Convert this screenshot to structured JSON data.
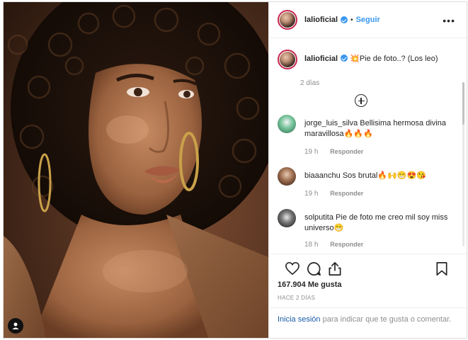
{
  "header": {
    "username": "lalioficial",
    "separator": "•",
    "follow_label": "Seguir",
    "more_label": "•••"
  },
  "caption": {
    "username": "lalioficial",
    "emoji": "💥",
    "text": "Pie de foto..? (Los leo)",
    "time": "2 días"
  },
  "comments": [
    {
      "username": "jorge_luis_silva",
      "text": "Bellisima hermosa divina maravillosa🔥🔥🔥",
      "time": "19 h",
      "reply_label": "Responder"
    },
    {
      "username": "biaaanchu",
      "text": "Sos brutal🔥🙌😁😍😘",
      "time": "19 h",
      "reply_label": "Responder"
    },
    {
      "username": "solputita",
      "text": "Pie de foto me creo mil soy miss universo😁",
      "time": "18 h",
      "reply_label": "Responder"
    }
  ],
  "footer": {
    "likes": "167.904 Me gusta",
    "date": "HACE 2 DÍAS",
    "login_link": "Inicia sesión",
    "login_text": " para indicar que te gusta o comentar."
  },
  "icons": {
    "heart": "heart-icon",
    "comment": "comment-icon",
    "share": "share-icon",
    "save": "bookmark-icon",
    "add": "plus-circle-icon",
    "tag": "user-tag-icon"
  },
  "colors": {
    "accent": "#3897f0",
    "link": "#1a5ba8",
    "muted": "#8e8e8e",
    "text": "#262626"
  }
}
